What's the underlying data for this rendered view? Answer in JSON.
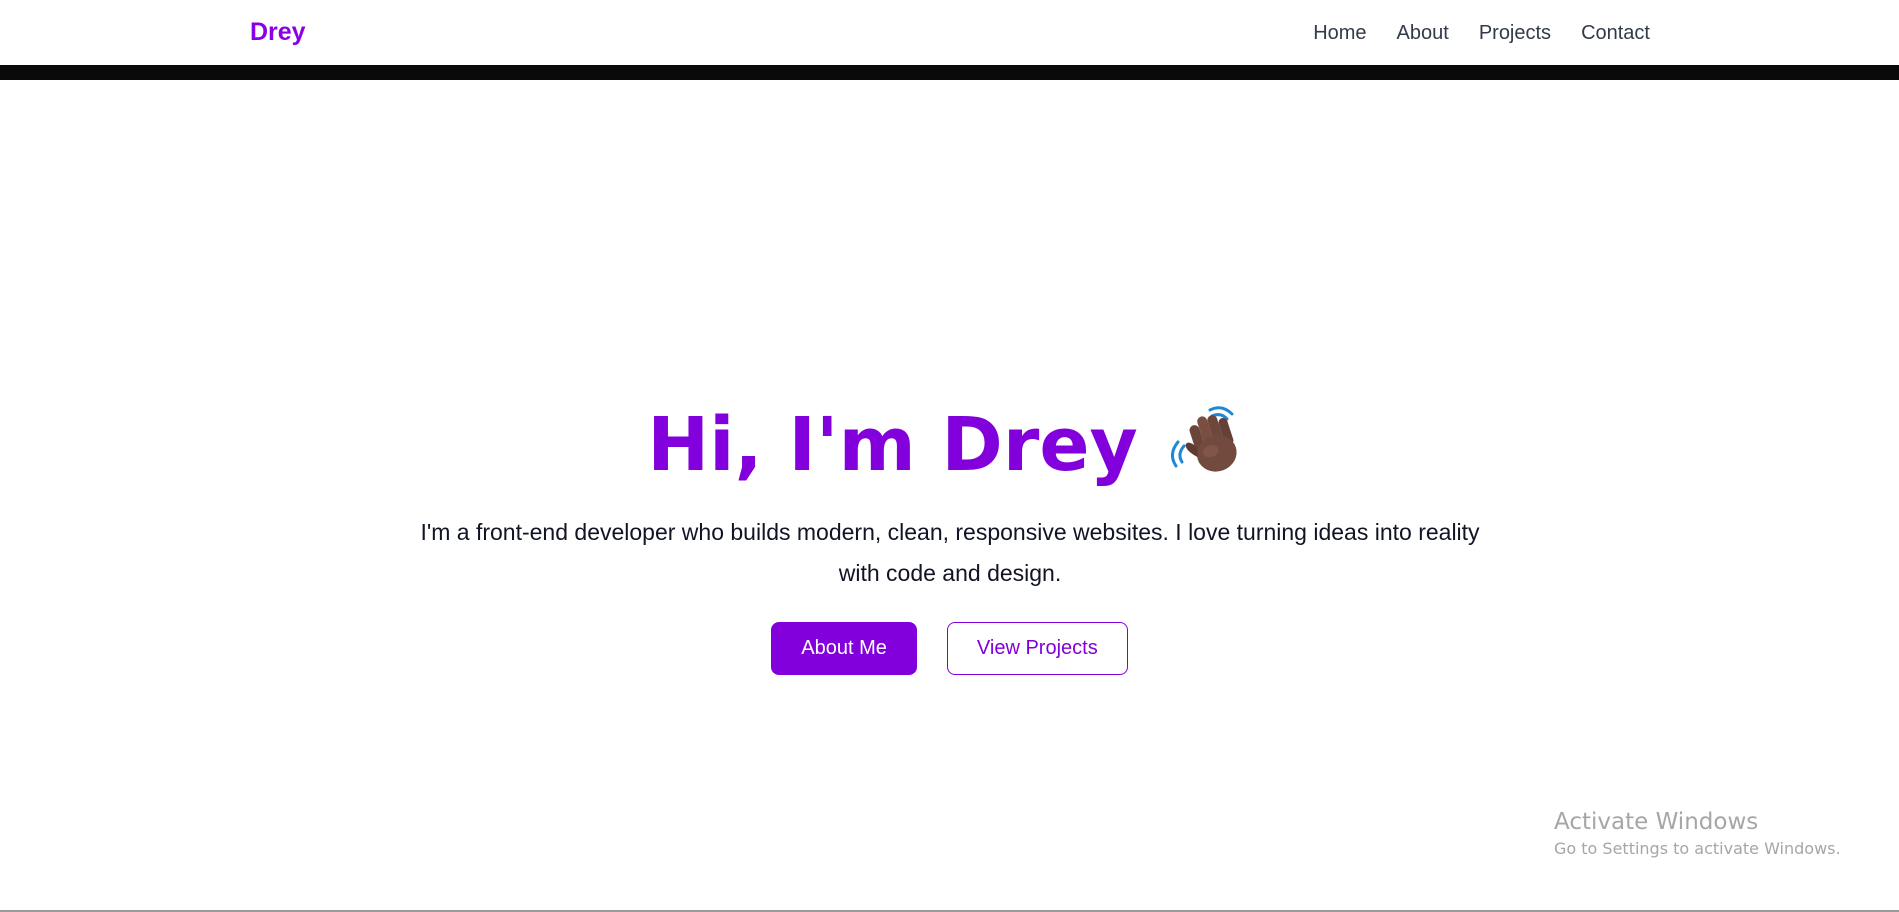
{
  "colors": {
    "accent": "#8200db",
    "brand": "#8a00e6",
    "nav_text": "#333a4a",
    "body_text": "#111424",
    "divider": "#0a0a0a"
  },
  "navbar": {
    "brand": "Drey",
    "links": [
      {
        "label": "Home"
      },
      {
        "label": "About"
      },
      {
        "label": "Projects"
      },
      {
        "label": "Contact"
      }
    ]
  },
  "hero": {
    "title": "Hi, I'm Drey",
    "title_icon": "waving-hand-icon",
    "description": "I'm a front-end developer who builds modern, clean, responsive websites. I love turning ideas into reality with code and design.",
    "primary_button": "About Me",
    "secondary_button": "View Projects"
  },
  "watermark": {
    "title": "Activate Windows",
    "subtitle": "Go to Settings to activate Windows."
  }
}
